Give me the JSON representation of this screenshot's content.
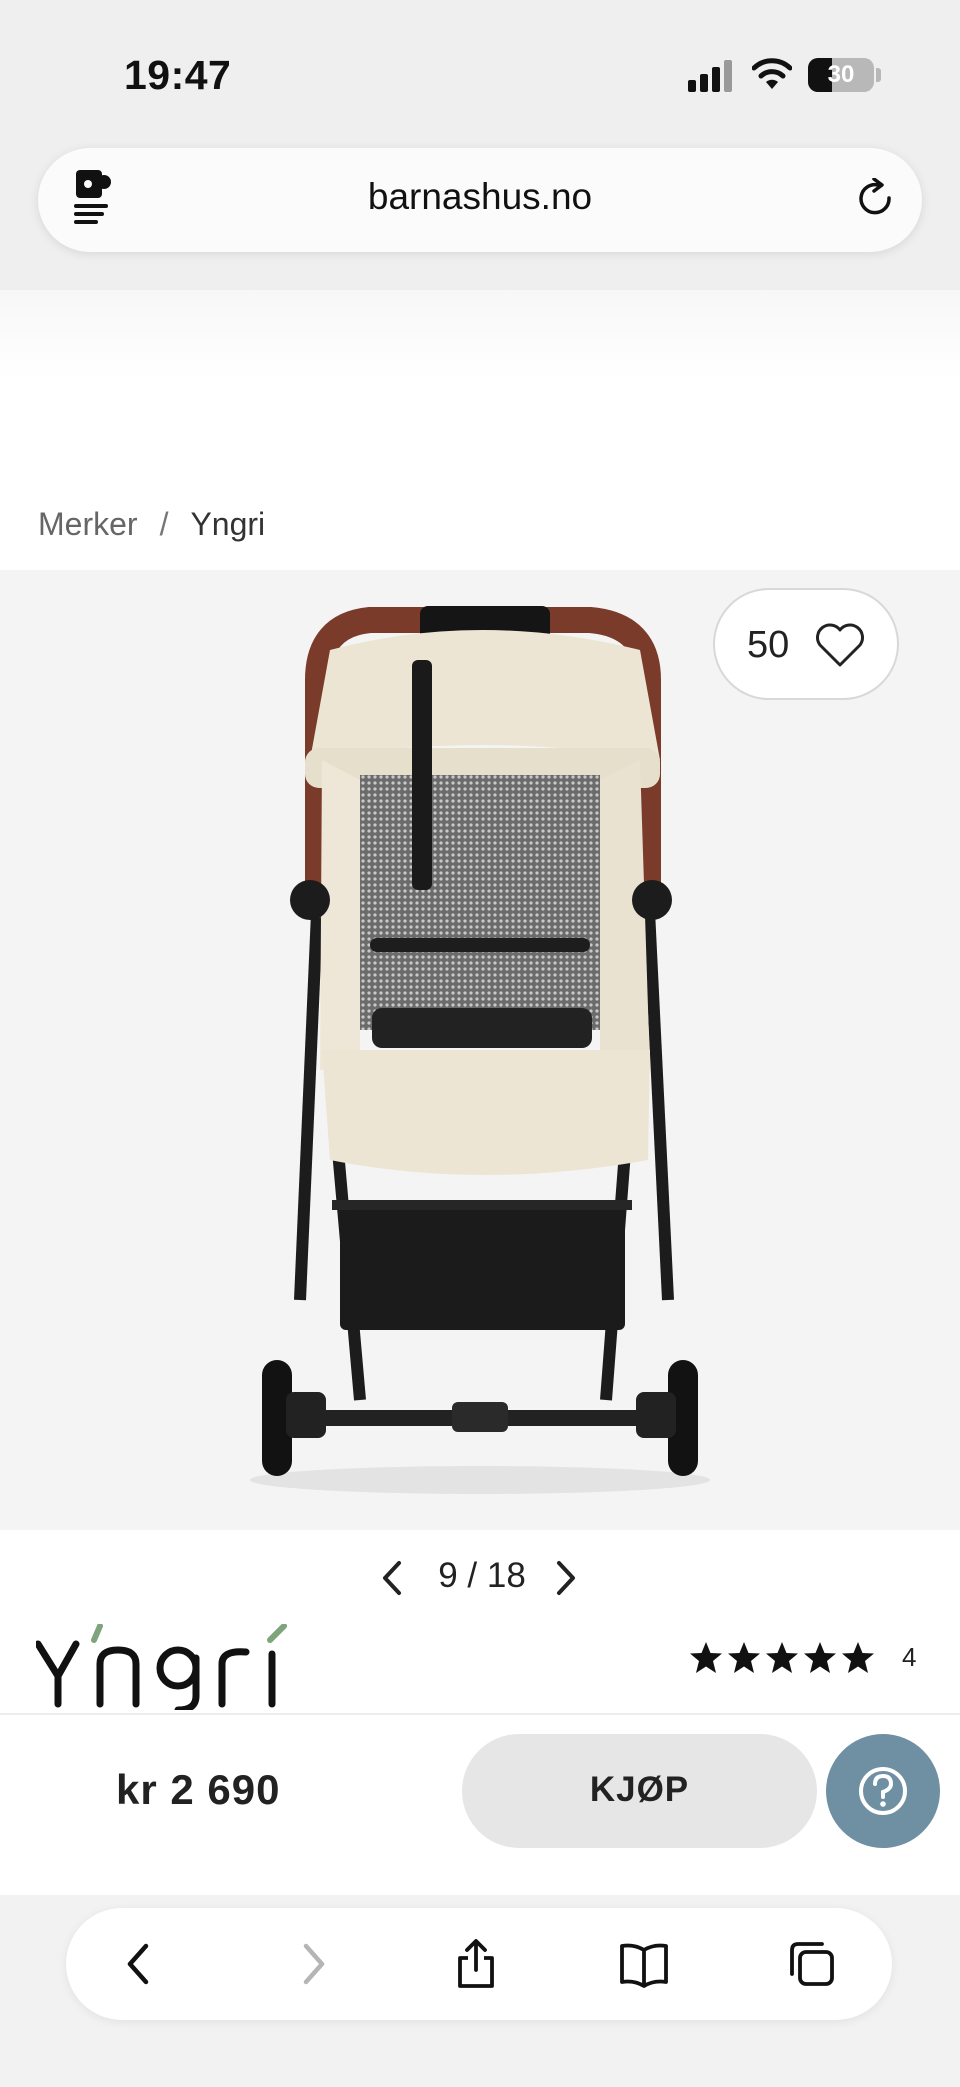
{
  "status_bar": {
    "time": "19:47",
    "battery": "30"
  },
  "browser": {
    "url": "barnashus.no"
  },
  "breadcrumb": {
    "items": [
      "Merker",
      "Yngri"
    ],
    "separator": "/"
  },
  "product": {
    "wishlist_count": "50",
    "image_index": "9",
    "image_total": "/ 18",
    "brand": "Yngri",
    "rating_stars": 5,
    "review_count": "4",
    "price": "kr 2 690",
    "buy_label": "KJØP"
  },
  "colors": {
    "help_button": "#6f8fa3",
    "buy_button": "#e6e6e6",
    "handlebar": "#7a3b2a",
    "canopy": "#efe9da"
  },
  "icons": [
    "site-settings-icon",
    "reload-icon",
    "heart-icon",
    "chevron-left-icon",
    "chevron-right-icon",
    "star-icon",
    "help-icon",
    "back-icon",
    "forward-icon",
    "share-icon",
    "bookmarks-icon",
    "tabs-icon"
  ]
}
